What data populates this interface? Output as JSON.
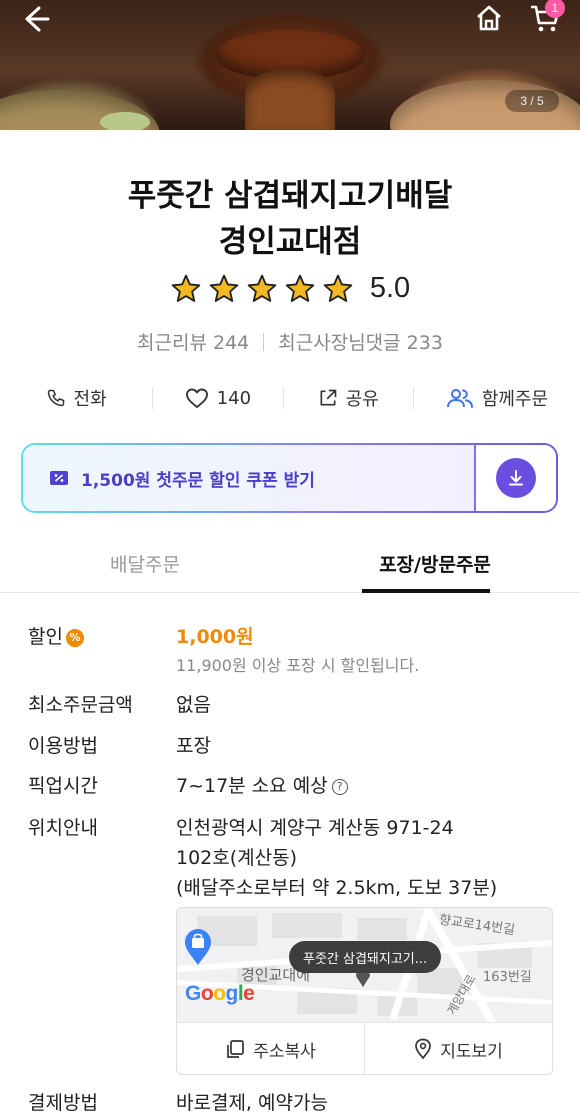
{
  "header": {
    "image_counter": "3 / 5",
    "cart_count": "1"
  },
  "store": {
    "name_line1": "푸줏간 삼겹돼지고기배달",
    "name_line2": "경인교대점",
    "rating": "5.0",
    "stars": 5
  },
  "reviews": {
    "recent_reviews": "최근리뷰 244",
    "owner_replies": "최근사장님댓글 233"
  },
  "actions": {
    "call": "전화",
    "likes": "140",
    "share": "공유",
    "group_order": "함께주문"
  },
  "coupon": {
    "text": "1,500원 첫주문 할인 쿠폰 받기"
  },
  "tabs": [
    {
      "label": "배달주문",
      "active": false
    },
    {
      "label": "포장/방문주문",
      "active": true
    }
  ],
  "info": {
    "discount_label": "할인",
    "discount_badge": "%",
    "discount_value": "1,000원",
    "discount_note": "11,900원 이상 포장 시 할인됩니다.",
    "min_order_label": "최소주문금액",
    "min_order_value": "없음",
    "method_label": "이용방법",
    "method_value": "포장",
    "pickup_label": "픽업시간",
    "pickup_value": "7~17분 소요 예상",
    "location_label": "위치안내",
    "address_line1": "인천광역시 계양구 계산동 971-24",
    "address_line2": "102호(계산동)",
    "address_line3": "(배달주소로부터 약 2.5km, 도보 37분)",
    "payment_label": "결제방법",
    "payment_value": "바로결제, 예약가능"
  },
  "map": {
    "tooltip": "푸줏간 삼겹돼지고기...",
    "label_area": "경인교대에",
    "label_road1": "향교로14번길",
    "label_road2": "163번길",
    "label_road3": "계양대로",
    "brand": "Google",
    "copy_address": "주소복사",
    "view_map": "지도보기"
  },
  "colors": {
    "accent_orange": "#f08a00",
    "coupon_purple": "#4b3ec8",
    "badge_pink": "#ff5aa5",
    "star_gold": "#f6b820"
  }
}
